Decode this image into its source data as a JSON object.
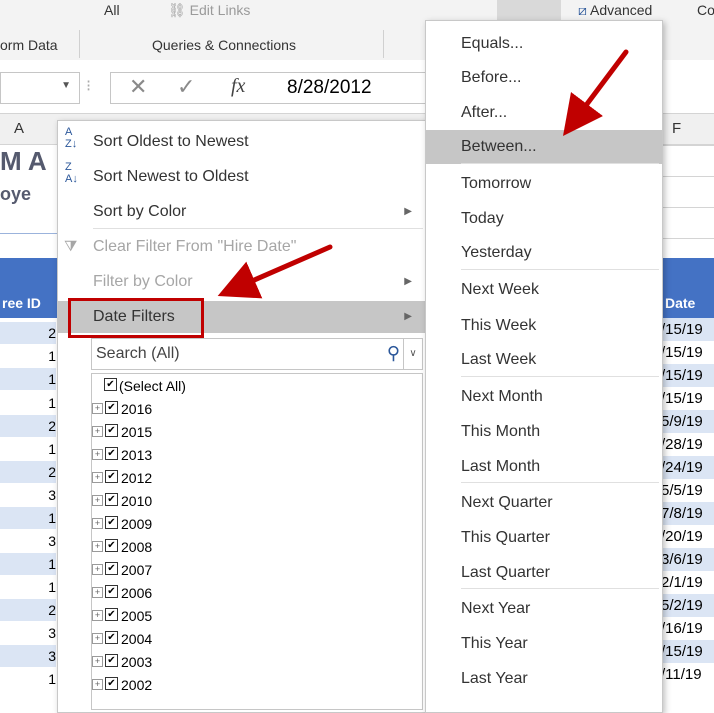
{
  "ribbon": {
    "filter_all": "All",
    "edit_links": "Edit Links",
    "advanced": "Advanced",
    "right_fragment": "Co",
    "form_data": "orm Data",
    "queries_connections": "Queries & Connections"
  },
  "formula_bar": {
    "cancel_icon": "✕",
    "enter_icon": "✓",
    "fx": "fx",
    "value": "8/28/2012"
  },
  "columns": {
    "a": "A",
    "f": "F"
  },
  "sheet": {
    "title_fragment": "M A",
    "subtitle_fragment": "oye",
    "header_fragment": "ree ID",
    "ids": [
      "2",
      "1",
      "1",
      "1",
      "2",
      "1",
      "2",
      "3",
      "1",
      "3",
      "1",
      "1",
      "2",
      "3",
      "3",
      "1"
    ],
    "date_header": "Date",
    "dates": [
      "/15/19",
      "/15/19",
      "/15/19",
      "/15/19",
      "5/9/19",
      "/28/19",
      "/24/19",
      "5/5/19",
      "7/8/19",
      "/20/19",
      "3/6/19",
      "2/1/19",
      "5/2/19",
      "/16/19",
      "/15/19",
      "/11/19"
    ]
  },
  "filter_menu": {
    "sort_oldest": "Sort Oldest to Newest",
    "sort_newest": "Sort Newest to Oldest",
    "sort_by_color": "Sort by Color",
    "clear_filter": "Clear Filter From \"Hire Date\"",
    "filter_by_color": "Filter by Color",
    "date_filters": "Date Filters",
    "search_placeholder": "Search (All)",
    "select_all": "(Select All)",
    "years": [
      "2016",
      "2015",
      "2013",
      "2012",
      "2010",
      "2009",
      "2008",
      "2007",
      "2006",
      "2005",
      "2004",
      "2003",
      "2002"
    ]
  },
  "date_submenu": {
    "items": [
      "Equals...",
      "Before...",
      "After...",
      "Between...",
      "Tomorrow",
      "Today",
      "Yesterday",
      "Next Week",
      "This Week",
      "Last Week",
      "Next Month",
      "This Month",
      "Last Month",
      "Next Quarter",
      "This Quarter",
      "Last Quarter",
      "Next Year",
      "This Year",
      "Last Year"
    ],
    "selected": "Between..."
  },
  "colors": {
    "accent_red": "#c00000",
    "header_blue": "#4472c4",
    "band_blue": "#dbe5f4",
    "hover_gray": "#c6c6c6"
  }
}
